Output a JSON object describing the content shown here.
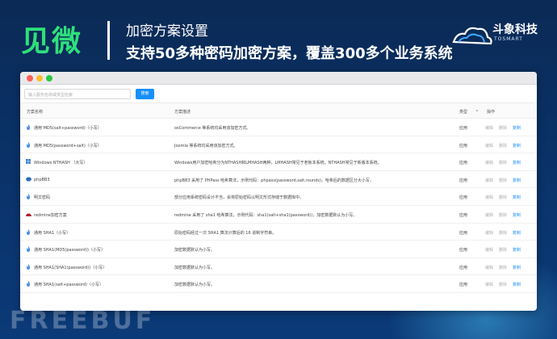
{
  "banner": {
    "brand": "见微",
    "title": "加密方案设置",
    "subtitle": "支持50多种密码加密方案，覆盖300多个业务系统",
    "company": "斗象科技",
    "company_en": "TOSMART"
  },
  "watermark": "FREEBUF",
  "toolbar": {
    "search_placeholder": "输入服务名称或类型检索",
    "search_button": "搜索"
  },
  "table": {
    "headers": {
      "name": "方案名称",
      "desc": "方案描述",
      "type": "类型",
      "action": "操作"
    },
    "actions": {
      "edit": "编辑",
      "delete": "删除",
      "copy": "复制"
    },
    "rows": [
      {
        "name": "通用 MD5(salt+password)（小写）",
        "desc": "osCommerce 等系统均采用该加密方式。",
        "type": "应用",
        "icon": "flame"
      },
      {
        "name": "通用 MD5(password+salt)（小写）",
        "desc": "Joomla 等系统均采用该加密方式。",
        "type": "应用",
        "icon": "flame"
      },
      {
        "name": "Windows NTHASH （大写）",
        "desc": "Windows用户加密哈希分为NTHASH和LMHASH两种，LMHASH常见于老板本系统，NTHASH常见于新版本系统。",
        "type": "应用",
        "icon": "windows"
      },
      {
        "name": "phpBB3",
        "desc": "phpBB3 采用了 PHPass 哈希算法，示例代码：phpass(password,salt,rounds)，哈希后的数据区分大小写。",
        "type": "应用",
        "icon": "phpbb"
      },
      {
        "name": "明文密码",
        "desc": "部分应用系统密码设计不当，会将原始密码以明文形式存储于数据库中。",
        "type": "应用",
        "icon": "flame"
      },
      {
        "name": "redmine加密方案",
        "desc": "redmine 采用了 sha1 哈希算法，示例代码：sha1(salt+sha1(password))，加密数据默认为小写。",
        "type": "应用",
        "icon": "redmine"
      },
      {
        "name": "通用 SHA1（小写）",
        "desc": "原始密码经过一次 SHA1 算法计算后的 16 进制字符串。",
        "type": "应用",
        "icon": "flame"
      },
      {
        "name": "通用 SHA1(MD5(password))（小写）",
        "desc": "加密数据默认为小写。",
        "type": "应用",
        "icon": "flame"
      },
      {
        "name": "通用 SHA1(SHA1(password))（小写）",
        "desc": "加密数据默认为小写。",
        "type": "应用",
        "icon": "flame"
      },
      {
        "name": "通用 SHA1(salt+password)（小写）",
        "desc": "加密数据默认为小写。",
        "type": "应用",
        "icon": "flame"
      }
    ]
  }
}
